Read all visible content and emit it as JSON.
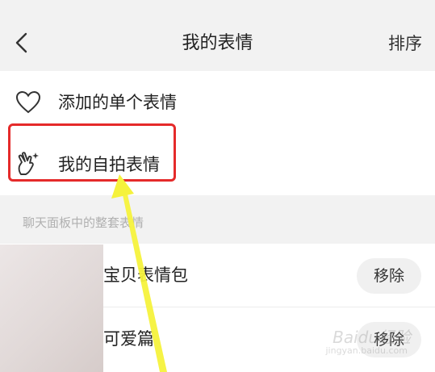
{
  "header": {
    "back_icon": "chevron-left-icon",
    "title": "我的表情",
    "sort_label": "排序"
  },
  "rows": {
    "added": {
      "icon": "heart-outline-icon",
      "label": "添加的单个表情"
    },
    "selfie": {
      "icon": "hand-sparkle-icon",
      "label": "我的自拍表情"
    }
  },
  "section": {
    "header": "聊天面板中的整套表情"
  },
  "packs": [
    {
      "name": "宝贝表情包",
      "action_label": "移除"
    },
    {
      "name": "可爱篇",
      "action_label": "移除"
    }
  ],
  "annotations": {
    "highlight_color": "#e52a2a",
    "arrow_color": "#f5f23c"
  },
  "watermark": {
    "text": "Baidu经验",
    "subtext": "jingyan.baidu.com"
  }
}
